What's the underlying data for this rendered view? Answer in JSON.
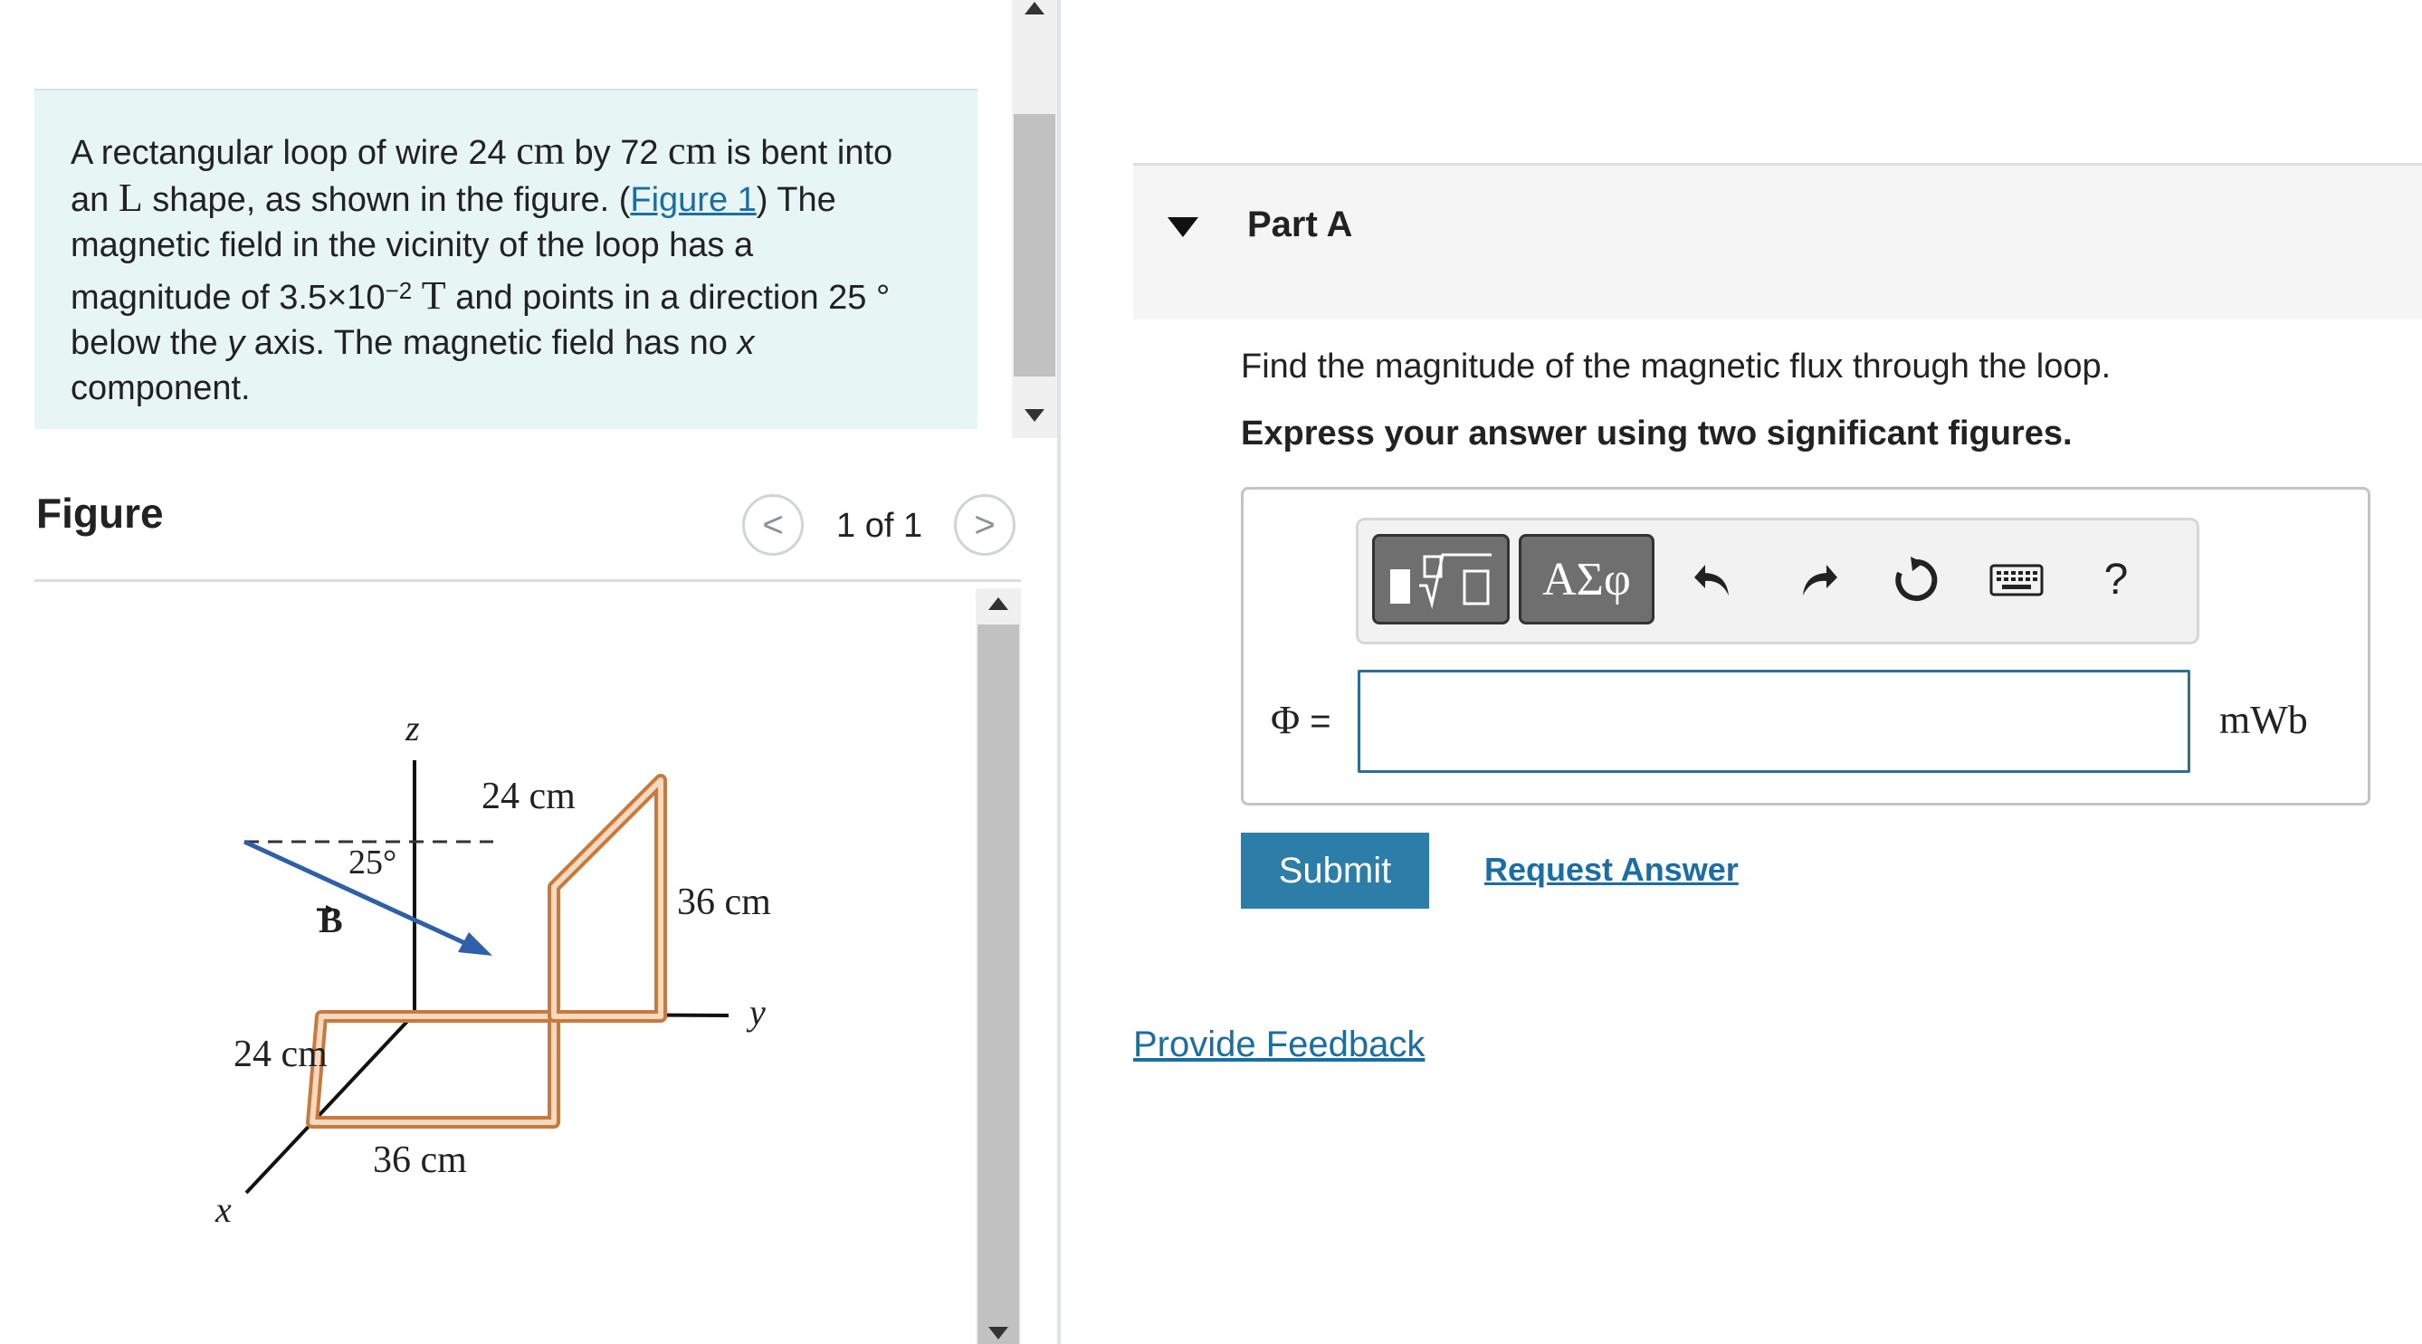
{
  "problem": {
    "t1": "A rectangular loop of wire 24 ",
    "u1": "cm",
    "t2": " by 72 ",
    "u2": "cm",
    "t3": " is bent into",
    "t4": "an ",
    "shape": "L",
    "t5": " shape, as shown in the figure. (",
    "figure_link": "Figure 1",
    "t6": ") The",
    "t7": "magnetic field in the vicinity of the loop has a",
    "t8": "magnitude of 3.5×10",
    "exp": "−2",
    "t9": " ",
    "unit_T": "T",
    "t10": " and points in a direction 25 °",
    "t11": "below the ",
    "axis_y": "y",
    "t12": " axis. The magnetic field has no ",
    "axis_x": "x",
    "t13": "component."
  },
  "figure": {
    "heading": "Figure",
    "prev_icon": "<",
    "next_icon": ">",
    "page_count": "1 of 1",
    "labels": {
      "z": "z",
      "y": "y",
      "x": "x",
      "B": "B",
      "angle": "25°",
      "top_width": "24 cm",
      "height": "36 cm",
      "side": "24 cm",
      "bottom": "36 cm"
    }
  },
  "part": {
    "title": "Part A",
    "question": "Find the magnitude of the magnetic flux through the loop.",
    "instruction": "Express your answer using two significant figures."
  },
  "toolbar": {
    "greek_label": "ΑΣφ",
    "help_label": "?",
    "icons": [
      "template-icon",
      "undo-icon",
      "redo-icon",
      "reset-icon",
      "keyboard-icon"
    ]
  },
  "answer": {
    "variable": "Φ",
    "equals": " =",
    "value": "",
    "unit": "mWb"
  },
  "actions": {
    "submit": "Submit",
    "request_answer": "Request Answer",
    "feedback": "Provide Feedback"
  }
}
